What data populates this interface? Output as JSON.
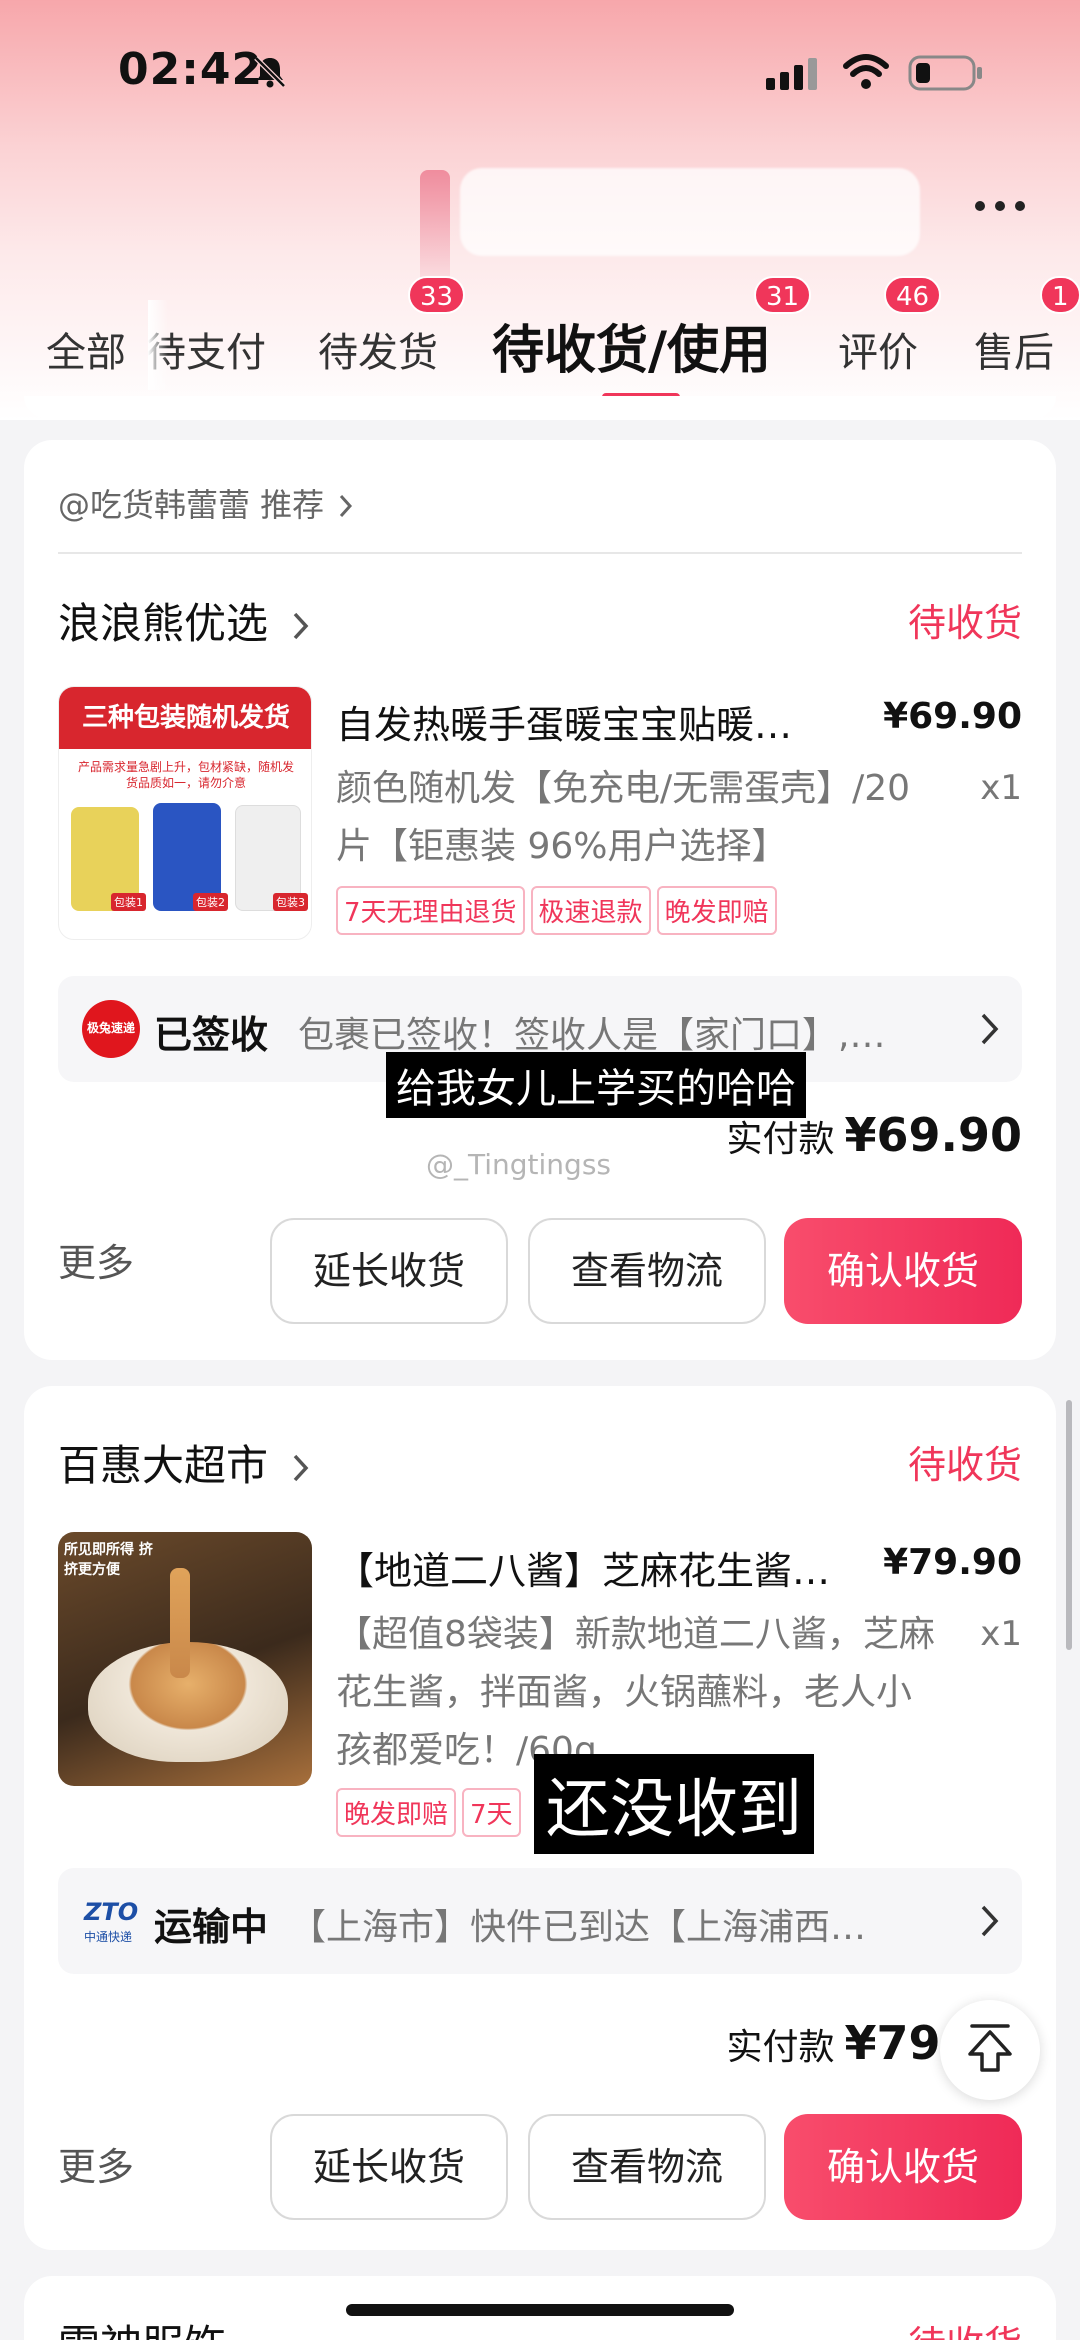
{
  "status_bar": {
    "time": "02:42"
  },
  "tabs": [
    {
      "label": "全部",
      "badge": ""
    },
    {
      "label": "待支付",
      "badge": ""
    },
    {
      "label": "待发货",
      "badge": "33"
    },
    {
      "label": "待收货/使用",
      "badge": "31",
      "active": true
    },
    {
      "label": "评价",
      "badge": "46"
    },
    {
      "label": "售后",
      "badge": "1"
    }
  ],
  "orders": [
    {
      "recommend": "@吃货韩蕾蕾 推荐",
      "shop": "浪浪熊优选",
      "status": "待收货",
      "product": {
        "image_caption_title": "三种包装随机发货",
        "image_caption_sub": "产品需求量急剧上升，包材紧缺，随机发货品质如一，请勿介意",
        "image_pack_labels": [
          "包装1",
          "包装2",
          "包装3"
        ],
        "title": "自发热暖手蛋暖宝宝贴暖…",
        "price": "¥69.90",
        "desc": "颜色随机发【免充电/无需蛋壳】/20片【钜惠装 96%用户选择】",
        "qty": "x1",
        "tags": [
          "7天无理由退货",
          "极速退款",
          "晚发即赔"
        ]
      },
      "logistics": {
        "carrier_badge": "极兔速递",
        "status": "已签收",
        "text": "包裹已签收！签收人是【家门口】,…"
      },
      "pay_label": "实付款",
      "pay_amount": "¥69.90",
      "more": "更多",
      "buttons": [
        "延长收货",
        "查看物流",
        "确认收货"
      ]
    },
    {
      "shop": "百惠大超市",
      "status": "待收货",
      "product": {
        "image_caption": "所见即所得 挤挤更方便",
        "title": "【地道二八酱】芝麻花生酱…",
        "price": "¥79.90",
        "desc": "【超值8袋装】新款地道二八酱，芝麻花生酱，拌面酱，火锅蘸料，老人小孩都爱吃！/60g",
        "qty": "x1",
        "tags": [
          "晚发即赔",
          "7天"
        ]
      },
      "logistics": {
        "carrier_badge": "ZTO",
        "carrier_sub": "中通快递",
        "status": "运输中",
        "text": "【上海市】快件已到达【上海浦西…"
      },
      "pay_label": "实付款",
      "pay_amount": "¥79.90",
      "more": "更多",
      "buttons": [
        "延长收货",
        "查看物流",
        "确认收货"
      ]
    },
    {
      "shop": "雷神服饰",
      "status": "待收货"
    }
  ],
  "captions": {
    "first": "给我女儿上学买的哈哈",
    "second": "还没收到"
  },
  "watermark": "@_Tingtingss",
  "colors": {
    "accent": "#f0365a",
    "background": "#f4f4f6"
  }
}
